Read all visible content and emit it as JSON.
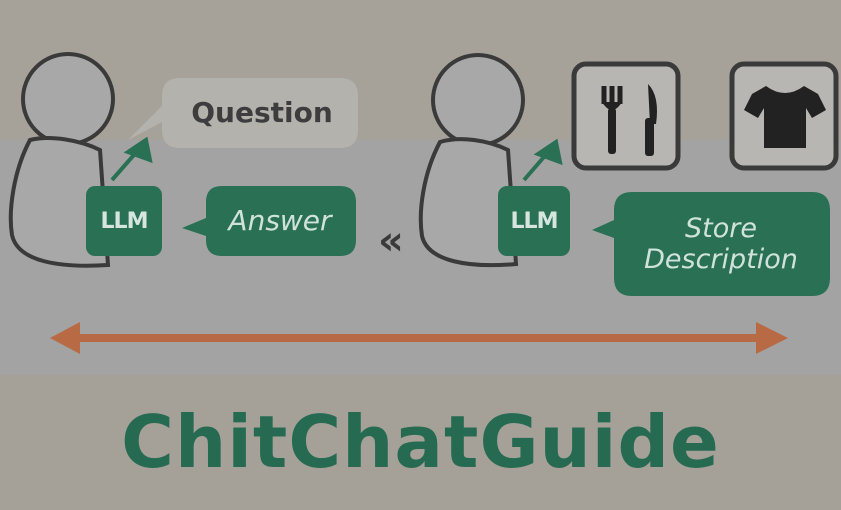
{
  "diagram": {
    "question_label": "Question",
    "answer_label": "Answer",
    "llm_label_left": "LLM",
    "llm_label_right": "LLM",
    "store_description_label": "Store Description",
    "title": "ChitChatGuide",
    "icons": [
      "person-icon",
      "person-icon",
      "fork-knife-icon",
      "tshirt-icon",
      "double-chevron-left-icon",
      "double-arrow-icon"
    ],
    "colors": {
      "green": "#2a7055",
      "arrow_orange": "#b86a45",
      "outline": "#333333",
      "figure_fill": "#a8a8a8"
    }
  }
}
